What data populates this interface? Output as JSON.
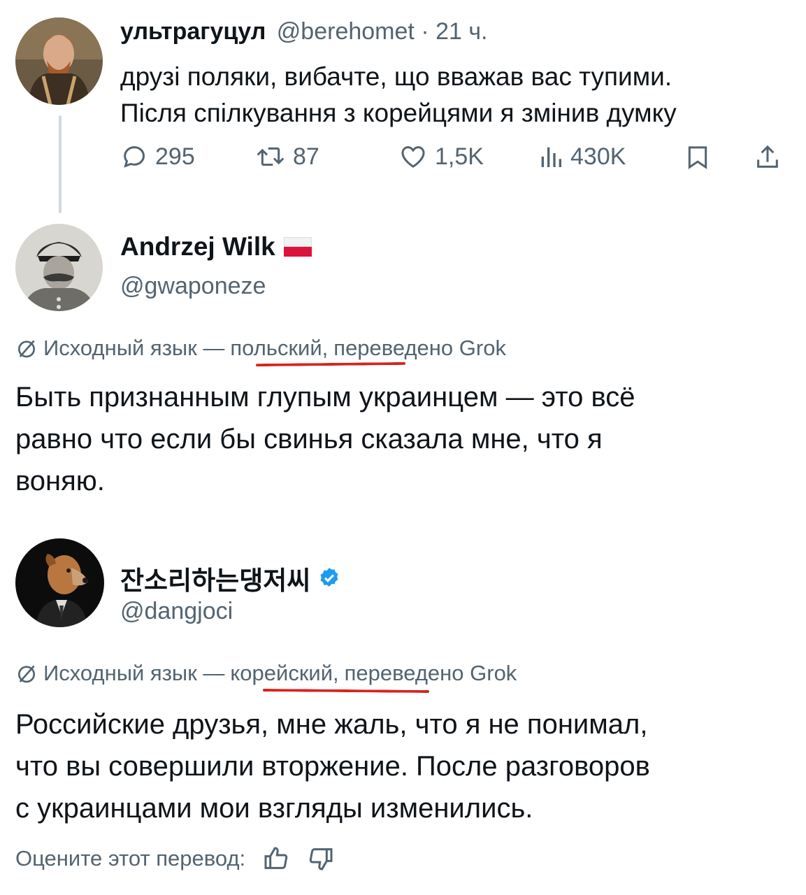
{
  "tweet1": {
    "display_name": "ультрагуцул",
    "handle": "@berehomet",
    "time": "· 21 ч.",
    "text_line1": "друзі поляки, вибачте, що вважав вас тупими.",
    "text_line2": "Після спілкування з корейцями я змінив думку",
    "stats": {
      "replies": "295",
      "reposts": "87",
      "likes": "1,5K",
      "views": "430K"
    }
  },
  "tweet2": {
    "display_name": "Andrzej Wilk",
    "handle": "@gwaponeze",
    "translation_prefix": "Исходный язык —",
    "translation_lang": "польский,",
    "translation_suffix": "переведено Grok",
    "text_line1": "Быть признанным глупым украинцем — это всё",
    "text_line2": "равно что если бы свинья сказала мне, что я",
    "text_line3": "воняю."
  },
  "tweet3": {
    "display_name": "잔소리하는댕저씨",
    "handle": "@dangjoci",
    "translation_prefix": "Исходный язык —",
    "translation_lang": "корейский,",
    "translation_suffix": "переведено Grok",
    "text_line1": "Российские друзья, мне жаль, что я не понимал,",
    "text_line2": "что вы совершили вторжение. После разговоров",
    "text_line3": "с украинцами мои взгляды изменились.",
    "rate_label": "Оцените этот перевод:"
  },
  "colors": {
    "verified": "#1d9bf0",
    "underline": "#d8231f",
    "secondary_text": "#536471"
  },
  "icons": [
    "reply-icon",
    "repost-icon",
    "like-icon",
    "views-icon",
    "bookmark-icon",
    "share-icon",
    "translate-icon",
    "verified-badge-icon",
    "thumbs-up-icon",
    "thumbs-down-icon",
    "poland-flag-icon"
  ]
}
